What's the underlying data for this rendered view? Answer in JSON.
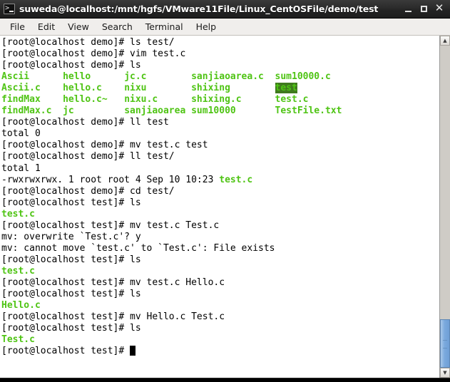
{
  "window": {
    "title": "suweda@localhost:/mnt/hgfs/VMware11File/Linux_CentOSFile/demo/test",
    "icon": "terminal-icon",
    "controls": {
      "minimize": "_",
      "maximize": "□",
      "close": "✕"
    }
  },
  "menubar": {
    "items": [
      {
        "label": "File"
      },
      {
        "label": "Edit"
      },
      {
        "label": "View"
      },
      {
        "label": "Search"
      },
      {
        "label": "Terminal"
      },
      {
        "label": "Help"
      }
    ]
  },
  "scrollbar": {
    "up_arrow": "▲",
    "down_arrow": "▼"
  },
  "terminal": {
    "colors": {
      "background": "#ffffff",
      "foreground": "#000000",
      "green": "#4fc414",
      "dir_highlight_bg": "#3f7a1e"
    },
    "lines": [
      {
        "segments": [
          {
            "text": "[root@localhost demo]# ls test/",
            "style": "plain"
          }
        ]
      },
      {
        "segments": [
          {
            "text": "[root@localhost demo]# vim test.c",
            "style": "plain"
          }
        ]
      },
      {
        "segments": [
          {
            "text": "[root@localhost demo]# ls",
            "style": "plain"
          }
        ]
      },
      {
        "segments": [
          {
            "text": "Ascii      ",
            "style": "green-bold"
          },
          {
            "text": "hello      ",
            "style": "green-bold"
          },
          {
            "text": "jc.c        ",
            "style": "green-bold"
          },
          {
            "text": "sanjiaoarea.c  ",
            "style": "green-bold"
          },
          {
            "text": "sum10000.c",
            "style": "green-bold"
          }
        ]
      },
      {
        "segments": [
          {
            "text": "Ascii.c    ",
            "style": "green-bold"
          },
          {
            "text": "hello.c    ",
            "style": "green-bold"
          },
          {
            "text": "nixu        ",
            "style": "green-bold"
          },
          {
            "text": "shixing        ",
            "style": "green-bold"
          },
          {
            "text": "test",
            "style": "dir-highlight"
          }
        ]
      },
      {
        "segments": [
          {
            "text": "findMax    ",
            "style": "green-bold"
          },
          {
            "text": "hello.c~   ",
            "style": "green-bold"
          },
          {
            "text": "nixu.c      ",
            "style": "green-bold"
          },
          {
            "text": "shixing.c      ",
            "style": "green-bold"
          },
          {
            "text": "test.c",
            "style": "green-bold"
          }
        ]
      },
      {
        "segments": [
          {
            "text": "findMax.c  ",
            "style": "green-bold"
          },
          {
            "text": "jc         ",
            "style": "green-bold"
          },
          {
            "text": "sanjiaoarea ",
            "style": "green-bold"
          },
          {
            "text": "sum10000       ",
            "style": "green-bold"
          },
          {
            "text": "TestFile.txt",
            "style": "green-bold"
          }
        ]
      },
      {
        "segments": [
          {
            "text": "[root@localhost demo]# ll test",
            "style": "plain"
          }
        ]
      },
      {
        "segments": [
          {
            "text": "total 0",
            "style": "plain"
          }
        ]
      },
      {
        "segments": [
          {
            "text": "[root@localhost demo]# mv test.c test",
            "style": "plain"
          }
        ]
      },
      {
        "segments": [
          {
            "text": "[root@localhost demo]# ll test/",
            "style": "plain"
          }
        ]
      },
      {
        "segments": [
          {
            "text": "total 1",
            "style": "plain"
          }
        ]
      },
      {
        "segments": [
          {
            "text": "-rwxrwxrwx. 1 root root 4 Sep 10 10:23 ",
            "style": "plain"
          },
          {
            "text": "test.c",
            "style": "green-bold"
          }
        ]
      },
      {
        "segments": [
          {
            "text": "[root@localhost demo]# cd test/",
            "style": "plain"
          }
        ]
      },
      {
        "segments": [
          {
            "text": "[root@localhost test]# ls",
            "style": "plain"
          }
        ]
      },
      {
        "segments": [
          {
            "text": "test.c",
            "style": "green-bold"
          }
        ]
      },
      {
        "segments": [
          {
            "text": "[root@localhost test]# mv test.c Test.c",
            "style": "plain"
          }
        ]
      },
      {
        "segments": [
          {
            "text": "mv: overwrite `Test.c'? y",
            "style": "plain"
          }
        ]
      },
      {
        "segments": [
          {
            "text": "mv: cannot move `test.c' to `Test.c': File exists",
            "style": "plain"
          }
        ]
      },
      {
        "segments": [
          {
            "text": "[root@localhost test]# ls",
            "style": "plain"
          }
        ]
      },
      {
        "segments": [
          {
            "text": "test.c",
            "style": "green-bold"
          }
        ]
      },
      {
        "segments": [
          {
            "text": "[root@localhost test]# mv test.c Hello.c",
            "style": "plain"
          }
        ]
      },
      {
        "segments": [
          {
            "text": "[root@localhost test]# ls",
            "style": "plain"
          }
        ]
      },
      {
        "segments": [
          {
            "text": "Hello.c",
            "style": "green-bold"
          }
        ]
      },
      {
        "segments": [
          {
            "text": "[root@localhost test]# mv Hello.c Test.c",
            "style": "plain"
          }
        ]
      },
      {
        "segments": [
          {
            "text": "[root@localhost test]# ls",
            "style": "plain"
          }
        ]
      },
      {
        "segments": [
          {
            "text": "Test.c",
            "style": "green-bold"
          }
        ]
      },
      {
        "segments": [
          {
            "text": "[root@localhost test]# ",
            "style": "plain"
          },
          {
            "text": "",
            "style": "cursor"
          }
        ]
      }
    ]
  }
}
